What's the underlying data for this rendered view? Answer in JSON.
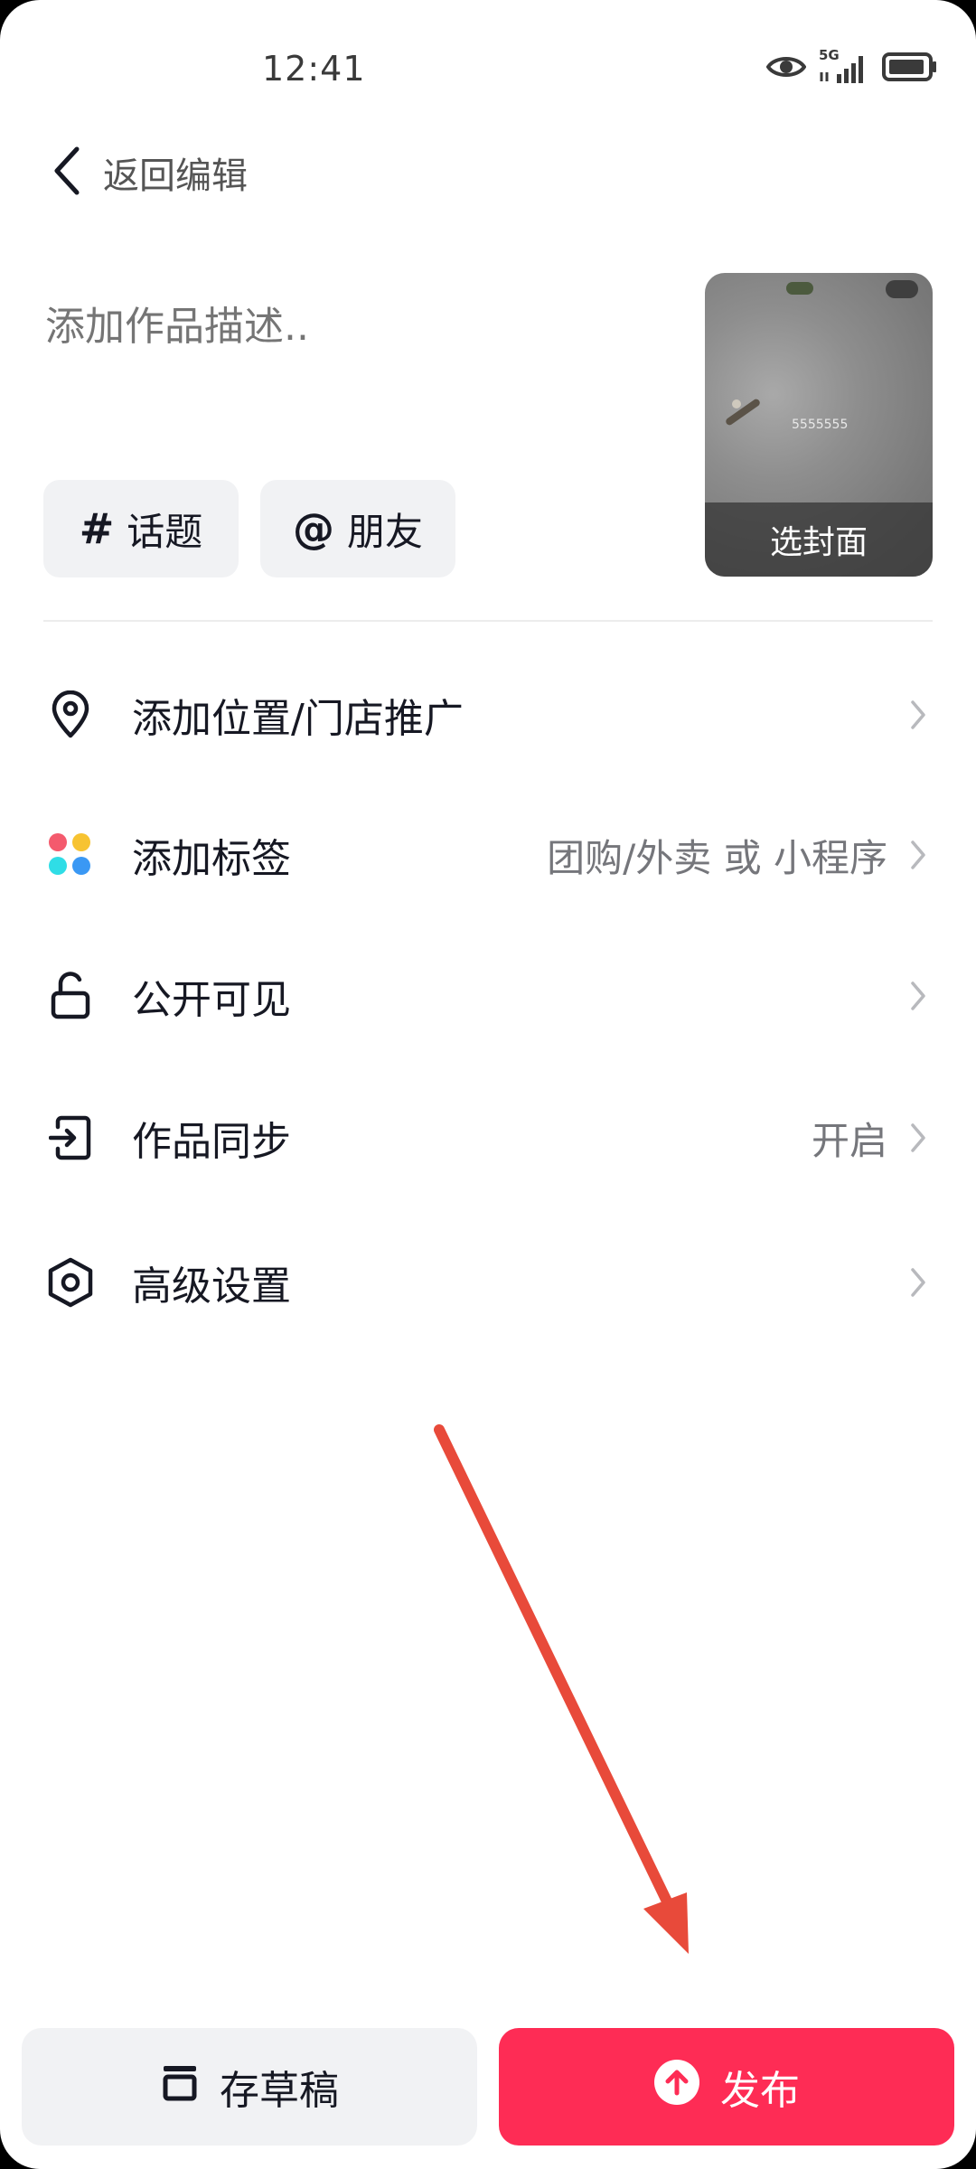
{
  "status_bar": {
    "time": "12:41",
    "network": "5G",
    "icons": [
      "eye-icon",
      "signal-icon",
      "battery-icon"
    ]
  },
  "header": {
    "back_label": "返回编辑"
  },
  "description": {
    "placeholder": "添加作品描述.."
  },
  "chips": [
    {
      "symbol": "#",
      "label": "话题"
    },
    {
      "symbol": "@",
      "label": "朋友"
    }
  ],
  "cover": {
    "button_label": "选封面",
    "overlay_text": "5555555"
  },
  "options": [
    {
      "icon": "location-pin-icon",
      "label": "添加位置/门店推广",
      "value": ""
    },
    {
      "icon": "dots-grid-icon",
      "label": "添加标签",
      "value": "团购/外卖 或 小程序"
    },
    {
      "icon": "unlock-icon",
      "label": "公开可见",
      "value": ""
    },
    {
      "icon": "sync-icon",
      "label": "作品同步",
      "value": "开启"
    },
    {
      "icon": "hexagon-settings-icon",
      "label": "高级设置",
      "value": ""
    }
  ],
  "footer": {
    "draft_label": "存草稿",
    "publish_label": "发布"
  },
  "colors": {
    "publish": "#fe2c55",
    "annotation_arrow": "#e84a3a"
  }
}
